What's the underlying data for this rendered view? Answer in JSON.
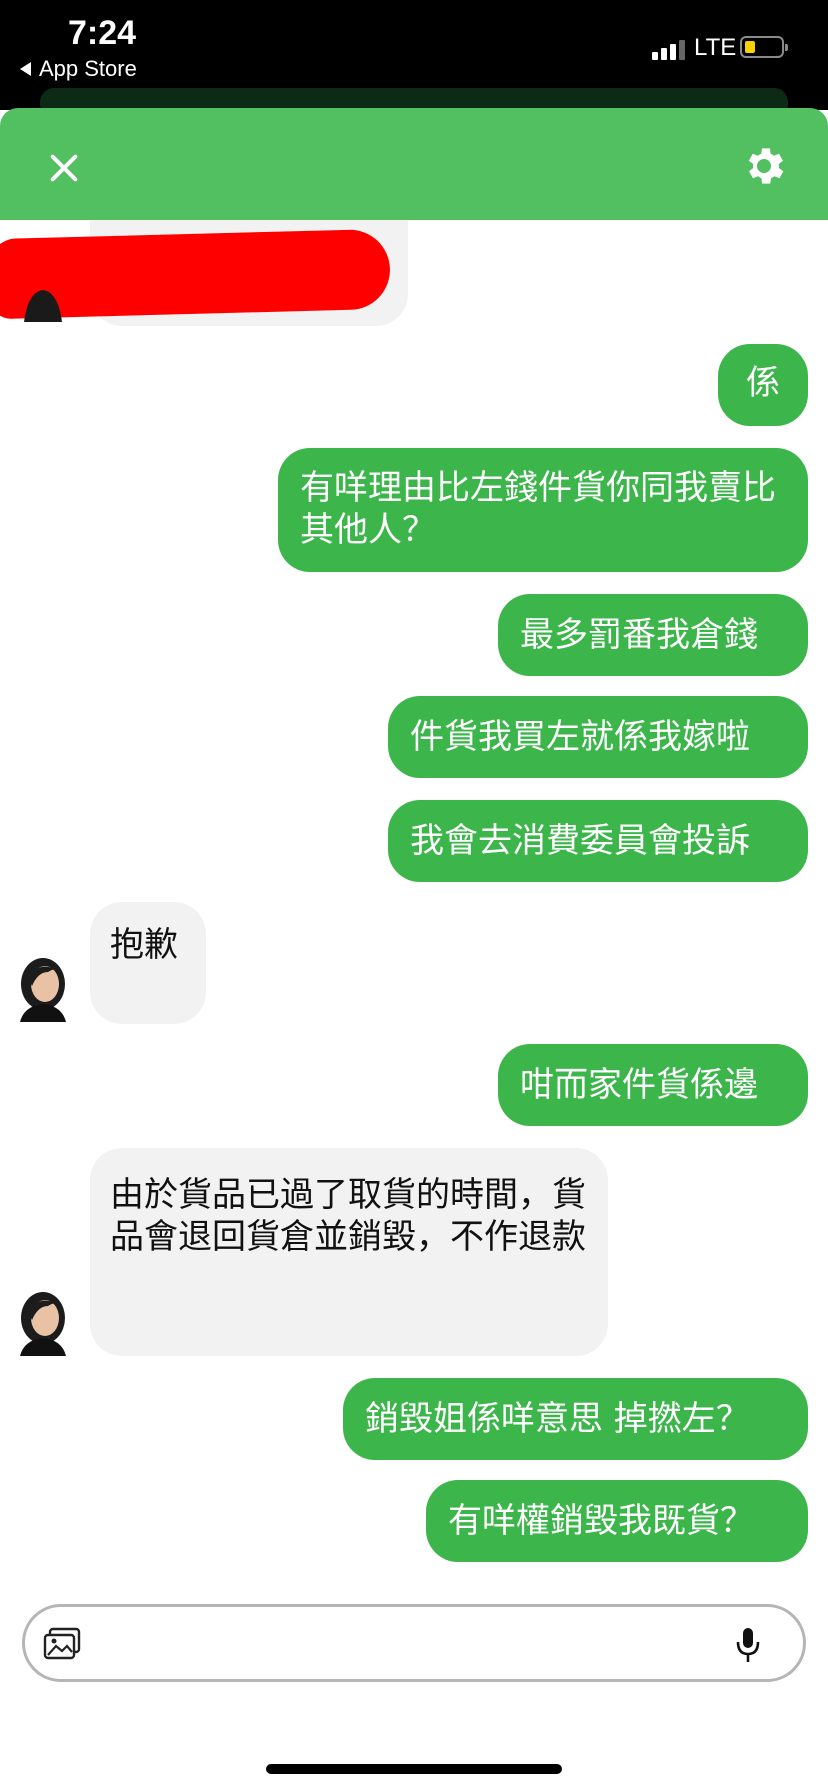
{
  "status_bar": {
    "time": "7:24",
    "back_label": "App Store",
    "network": "LTE"
  },
  "colors": {
    "header": "#52bf61",
    "outgoing_bubble": "#3cb64b",
    "incoming_bubble": "#f2f2f2"
  },
  "header": {
    "close_icon": "close-icon",
    "settings_icon": "gear-icon"
  },
  "messages": [
    {
      "side": "in",
      "text": "",
      "redacted": true
    },
    {
      "side": "out",
      "text": "係"
    },
    {
      "side": "out",
      "text": "有咩理由比左錢件貨你同我賣比其他人？"
    },
    {
      "side": "out",
      "text": "最多罰番我倉錢"
    },
    {
      "side": "out",
      "text": "件貨我買左就係我嫁啦"
    },
    {
      "side": "out",
      "text": "我會去消費委員會投訴"
    },
    {
      "side": "in",
      "text": "抱歉"
    },
    {
      "side": "out",
      "text": "咁而家件貨係邊"
    },
    {
      "side": "in",
      "text": "由於貨品已過了取貨的時間，貨品會退回貨倉並銷毀，不作退款"
    },
    {
      "side": "out",
      "text": "銷毀姐係咩意思 掉撚左？"
    },
    {
      "side": "out",
      "text": "有咩權銷毀我既貨？"
    }
  ],
  "composer": {
    "placeholder": "",
    "left_icon": "gallery-icon",
    "right_icon": "microphone-icon"
  }
}
